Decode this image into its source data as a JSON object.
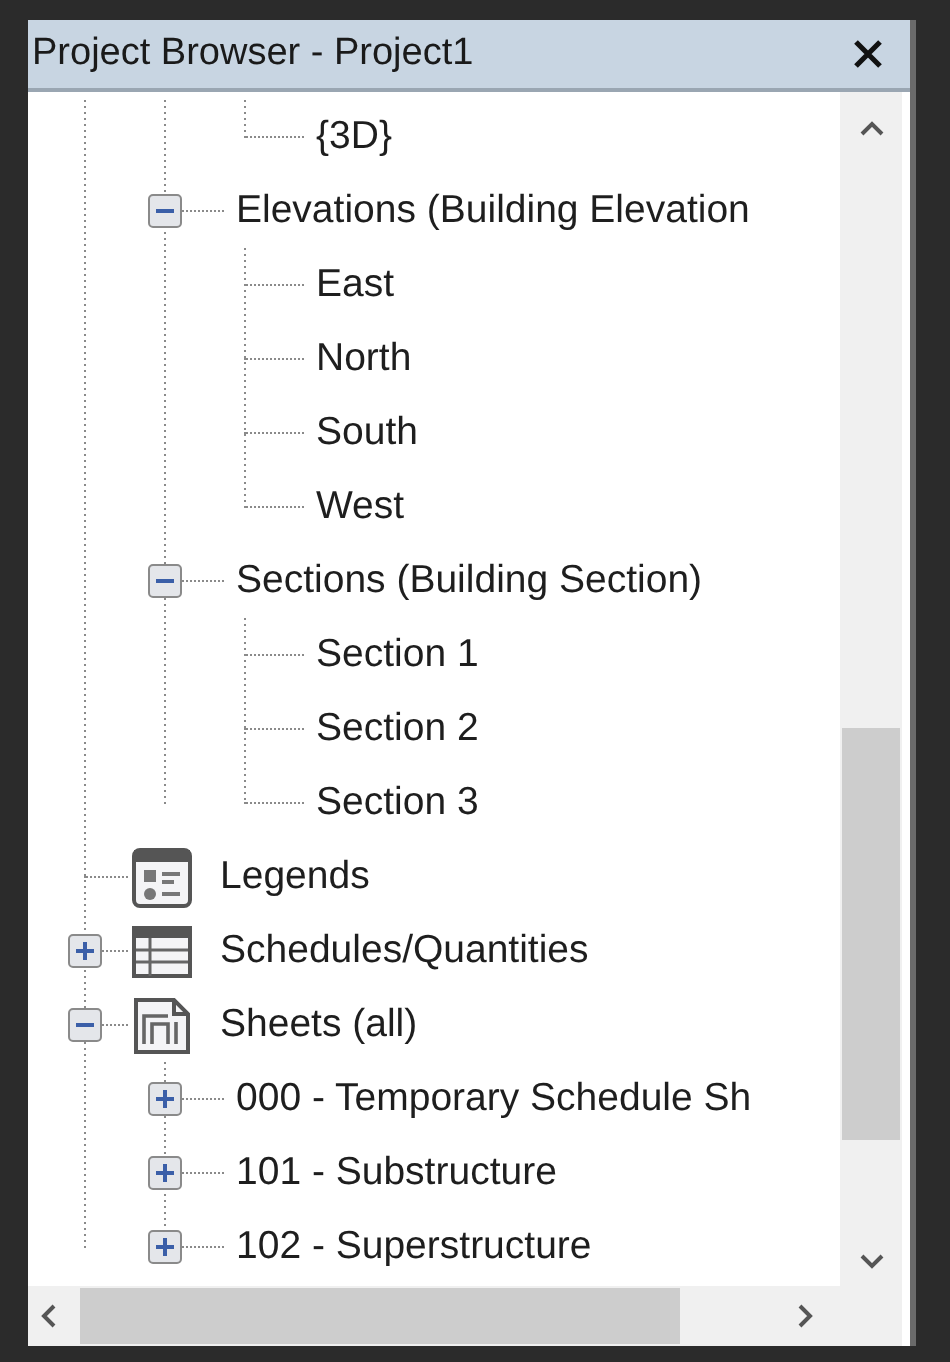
{
  "panel": {
    "title": "Project Browser - Project1"
  },
  "tree": [
    {
      "children": [
        {
          "children": [
            {
              "label": "{3D}"
            }
          ]
        },
        {
          "label": "Elevations (Building Elevation",
          "expanded": true,
          "children": [
            {
              "label": "East"
            },
            {
              "label": "North"
            },
            {
              "label": "South"
            },
            {
              "label": "West"
            }
          ]
        },
        {
          "label": "Sections (Building Section)",
          "expanded": true,
          "children": [
            {
              "label": "Section 1"
            },
            {
              "label": "Section 2"
            },
            {
              "label": "Section 3"
            }
          ]
        }
      ]
    },
    {
      "label": "Legends",
      "kind": "legend"
    },
    {
      "label": "Schedules/Quantities",
      "kind": "schedule",
      "expanded": false
    },
    {
      "label": "Sheets (all)",
      "kind": "sheet",
      "expanded": true,
      "children": [
        {
          "label": "000 - Temporary Schedule Sh",
          "expanded": false
        },
        {
          "label": "101 - Substructure",
          "expanded": false
        },
        {
          "label": "102 - Superstructure",
          "expanded": false
        }
      ]
    }
  ]
}
